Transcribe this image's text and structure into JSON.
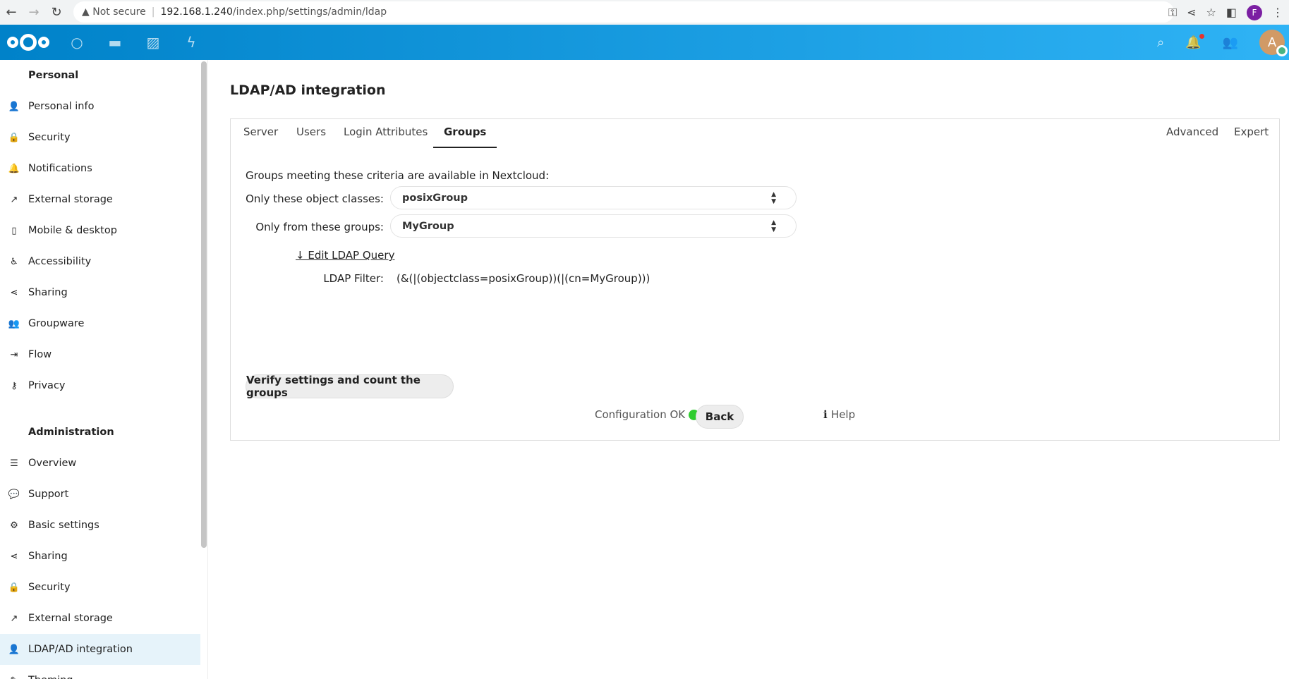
{
  "browser": {
    "not_secure": "Not secure",
    "url_host": "192.168.1.240",
    "url_path": "/index.php/settings/admin/ldap",
    "profile_initial": "F"
  },
  "header": {
    "avatar_initial": "A"
  },
  "sidebar": {
    "personal_heading": "Personal",
    "personal": [
      {
        "label": "Personal info",
        "icon": "👤",
        "name": "person-icon"
      },
      {
        "label": "Security",
        "icon": "🔒",
        "name": "lock-icon"
      },
      {
        "label": "Notifications",
        "icon": "🔔",
        "name": "bell-icon"
      },
      {
        "label": "External storage",
        "icon": "↗",
        "name": "external-icon"
      },
      {
        "label": "Mobile & desktop",
        "icon": "▯",
        "name": "phone-icon"
      },
      {
        "label": "Accessibility",
        "icon": "♿",
        "name": "accessibility-icon"
      },
      {
        "label": "Sharing",
        "icon": "⋖",
        "name": "share-icon"
      },
      {
        "label": "Groupware",
        "icon": "👥",
        "name": "groupware-icon"
      },
      {
        "label": "Flow",
        "icon": "⇥",
        "name": "flow-icon"
      },
      {
        "label": "Privacy",
        "icon": "⚷",
        "name": "key-icon"
      }
    ],
    "admin_heading": "Administration",
    "admin": [
      {
        "label": "Overview",
        "icon": "☰",
        "name": "list-icon"
      },
      {
        "label": "Support",
        "icon": "💬",
        "name": "support-icon"
      },
      {
        "label": "Basic settings",
        "icon": "⚙",
        "name": "gear-icon"
      },
      {
        "label": "Sharing",
        "icon": "⋖",
        "name": "share-icon"
      },
      {
        "label": "Security",
        "icon": "🔒",
        "name": "lock-icon"
      },
      {
        "label": "External storage",
        "icon": "↗",
        "name": "external-icon"
      },
      {
        "label": "LDAP/AD integration",
        "icon": "👤",
        "name": "person-icon",
        "active": true
      },
      {
        "label": "Theming",
        "icon": "✎",
        "name": "theming-icon"
      }
    ]
  },
  "main": {
    "title": "LDAP/AD integration",
    "tabs": [
      "Server",
      "Users",
      "Login Attributes",
      "Groups"
    ],
    "right_tabs": [
      "Advanced",
      "Expert"
    ],
    "intro": "Groups meeting these criteria are available in Nextcloud:",
    "object_classes_label": "Only these object classes:",
    "object_classes_value": "posixGroup",
    "groups_label": "Only from these groups:",
    "groups_value": "MyGroup",
    "edit_query": "↓ Edit LDAP Query",
    "filter_label": "LDAP Filter:",
    "filter_value": "(&(|(objectclass=posixGroup))(|(cn=MyGroup)))",
    "verify_button": "Verify settings and count the groups",
    "config_status": "Configuration OK",
    "back_button": "Back",
    "help": "Help"
  }
}
